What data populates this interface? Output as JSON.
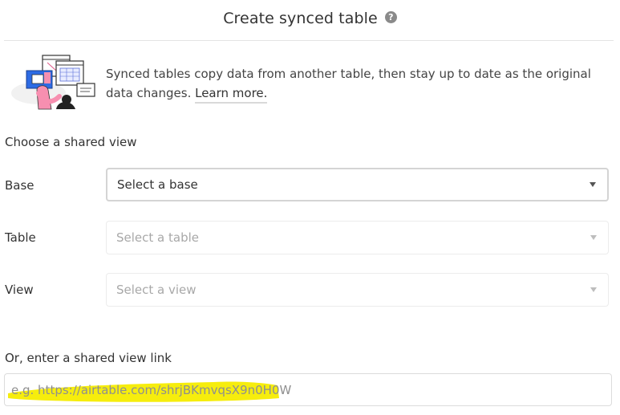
{
  "dialog": {
    "title": "Create synced table",
    "help_icon": "question-circle-icon"
  },
  "intro": {
    "text": "Synced tables copy data from another table, then stay up to date as the original data changes. ",
    "learn_more_label": "Learn more."
  },
  "shared_view": {
    "section_label": "Choose a shared view",
    "fields": [
      {
        "label": "Base",
        "value": "Select a base",
        "enabled": true
      },
      {
        "label": "Table",
        "value": "Select a table",
        "enabled": false
      },
      {
        "label": "View",
        "value": "Select a view",
        "enabled": false
      }
    ]
  },
  "link": {
    "section_label": "Or, enter a shared view link",
    "placeholder": "e.g. https://airtable.com/shrjBKmvqsX9n0H0W"
  },
  "colors": {
    "highlight": "#f5ec00",
    "illustration_blue": "#2d6be4",
    "illustration_pink": "#f78fb0"
  }
}
